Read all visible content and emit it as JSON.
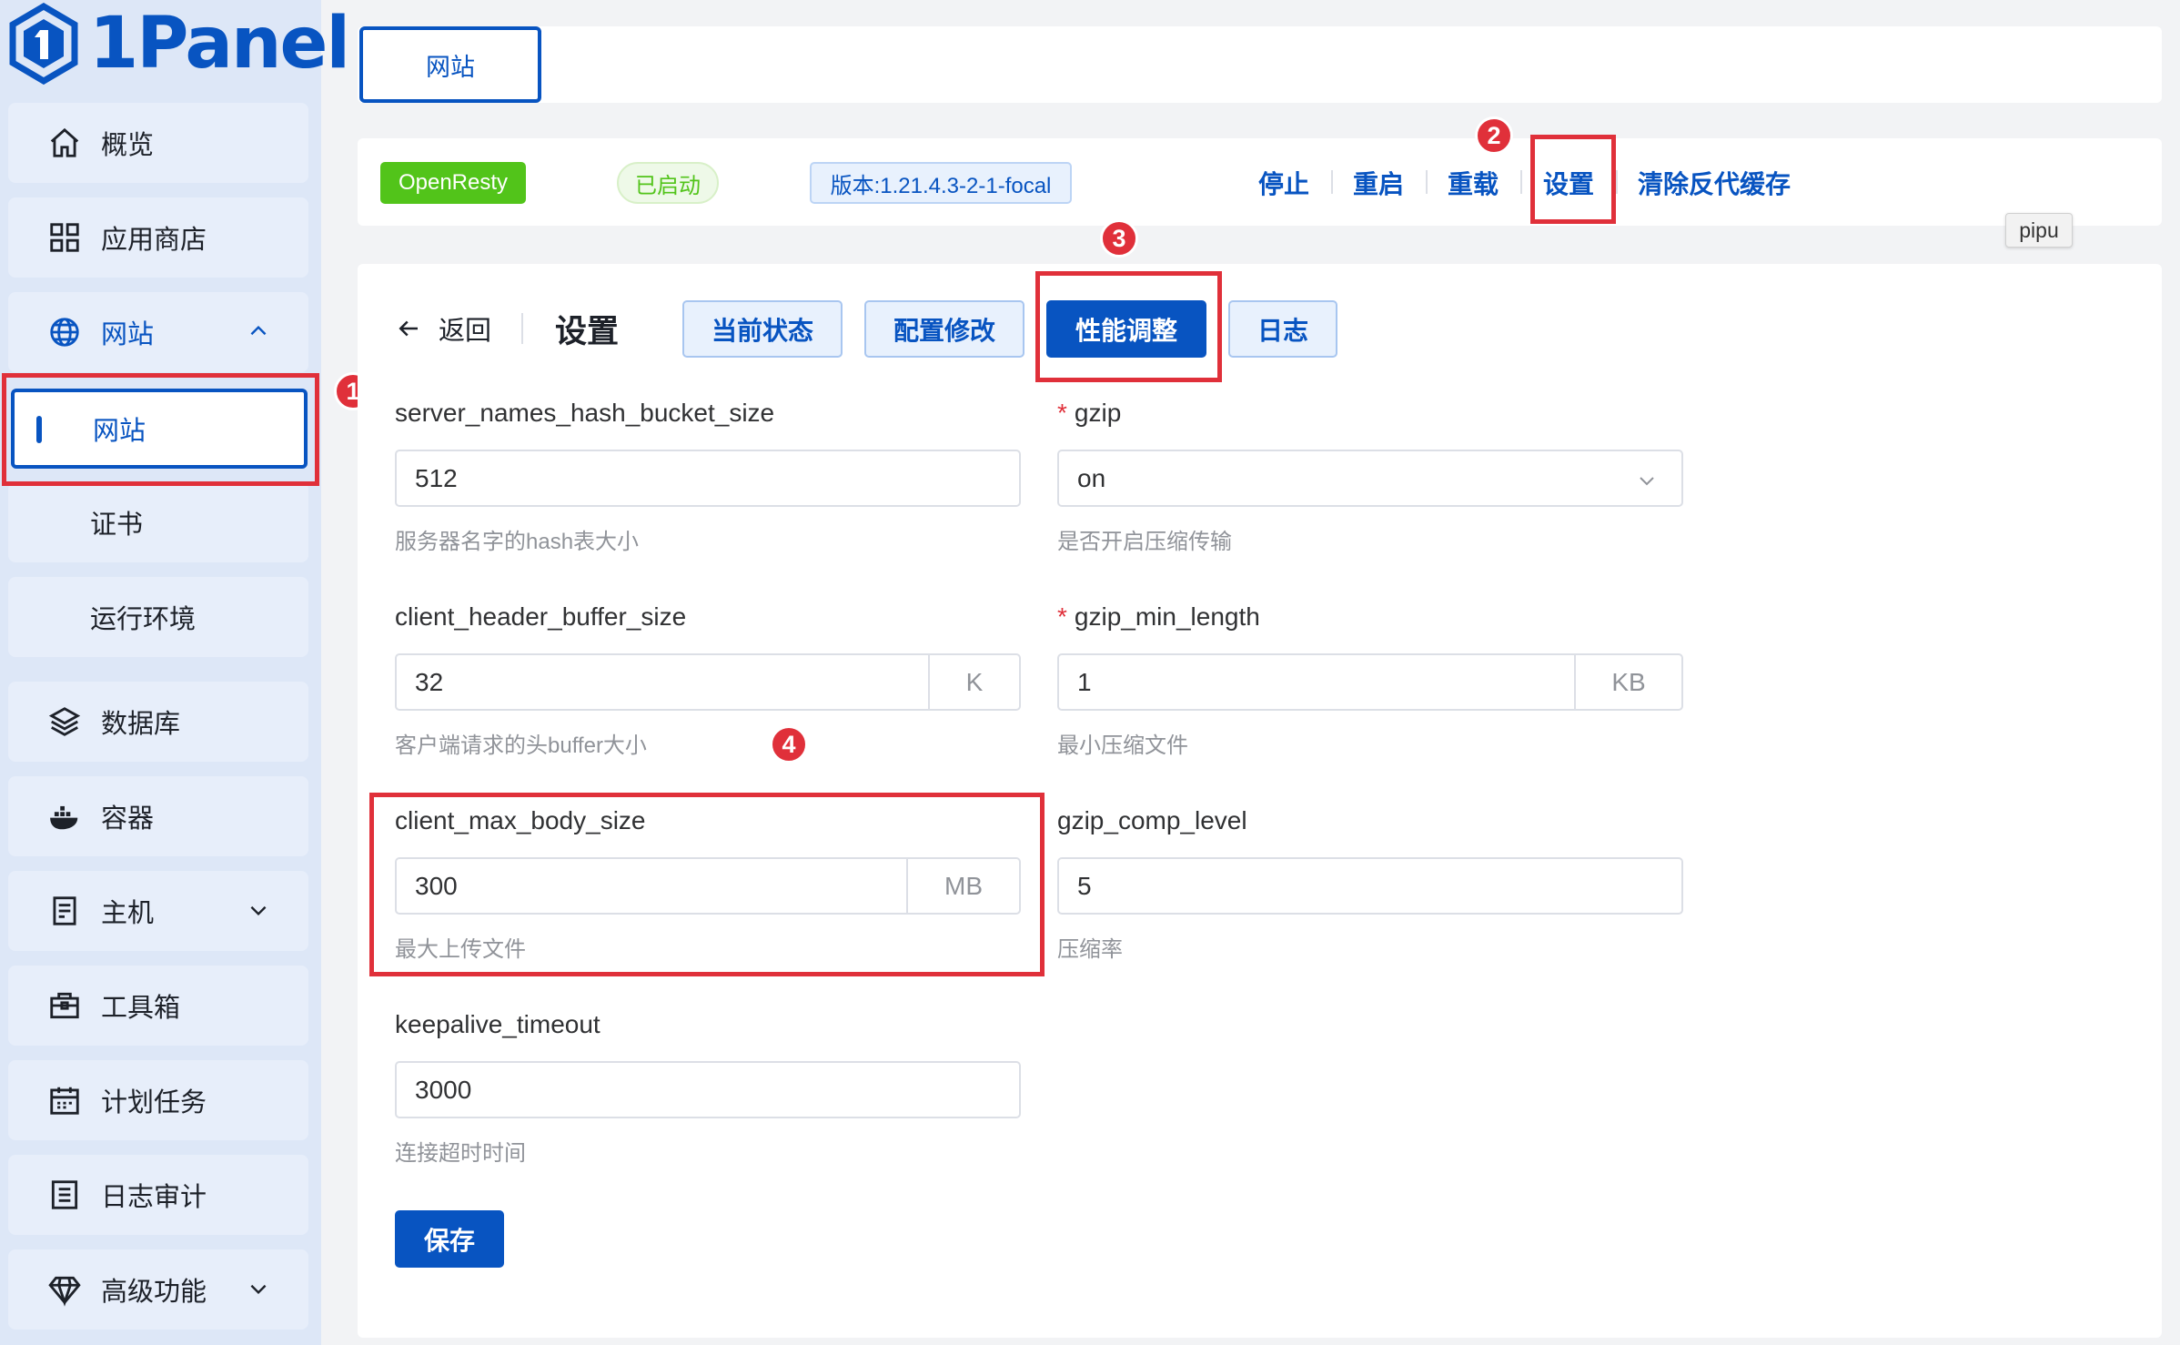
{
  "app": {
    "logo_text": "1Panel"
  },
  "sidebar": {
    "items": [
      {
        "label": "概览",
        "icon": "home-icon"
      },
      {
        "label": "应用商店",
        "icon": "grid-icon"
      },
      {
        "label": "网站",
        "icon": "globe-icon"
      },
      {
        "label": "数据库",
        "icon": "layers-icon"
      },
      {
        "label": "容器",
        "icon": "docker-icon"
      },
      {
        "label": "主机",
        "icon": "server-icon"
      },
      {
        "label": "工具箱",
        "icon": "toolbox-icon"
      },
      {
        "label": "计划任务",
        "icon": "calendar-icon"
      },
      {
        "label": "日志审计",
        "icon": "log-icon"
      },
      {
        "label": "高级功能",
        "icon": "diamond-icon"
      }
    ],
    "website_sub": [
      "网站",
      "证书",
      "运行环境"
    ]
  },
  "header": {
    "tab": "网站"
  },
  "infobar": {
    "app_tag": "OpenResty",
    "status": "已启动",
    "version": "版本:1.21.4.3-2-1-focal",
    "actions": [
      "停止",
      "重启",
      "重载",
      "设置",
      "清除反代缓存"
    ],
    "tooltip": "pipu"
  },
  "settings": {
    "back": "返回",
    "title": "设置",
    "tabs": [
      "当前状态",
      "配置修改",
      "性能调整",
      "日志"
    ],
    "save": "保存",
    "fields": {
      "snhbs": {
        "label": "server_names_hash_bucket_size",
        "value": "512",
        "help": "服务器名字的hash表大小"
      },
      "chbs": {
        "label": "client_header_buffer_size",
        "value": "32",
        "unit": "K",
        "help": "客户端请求的头buffer大小"
      },
      "cmbs": {
        "label": "client_max_body_size",
        "value": "300",
        "unit": "MB",
        "help": "最大上传文件"
      },
      "kt": {
        "label": "keepalive_timeout",
        "value": "3000",
        "help": "连接超时时间"
      },
      "gzip": {
        "label": "gzip",
        "value": "on",
        "help": "是否开启压缩传输"
      },
      "gml": {
        "label": "gzip_min_length",
        "value": "1",
        "unit": "KB",
        "help": "最小压缩文件"
      },
      "gcl": {
        "label": "gzip_comp_level",
        "value": "5",
        "help": "压缩率"
      }
    }
  },
  "annotations": [
    "1",
    "2",
    "3",
    "4"
  ],
  "colors": {
    "primary": "#0854c1",
    "annotation": "#e0303a",
    "success": "#52c41a"
  }
}
